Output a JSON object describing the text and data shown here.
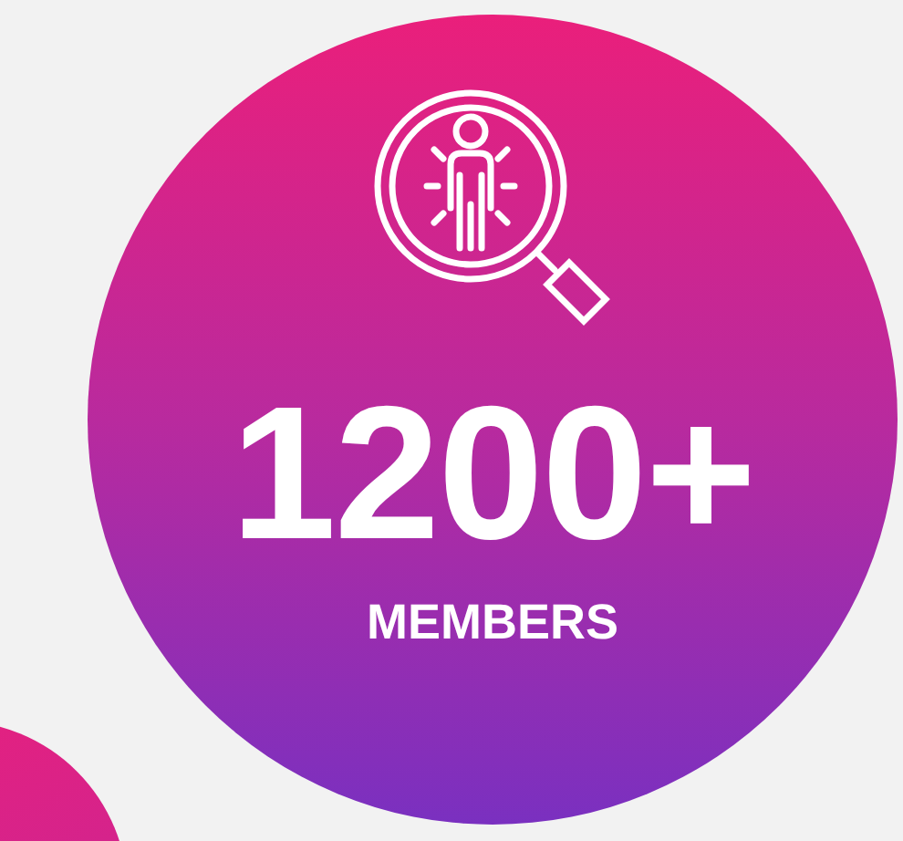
{
  "stat": {
    "value": "1200+",
    "label": "MEMBERS"
  }
}
